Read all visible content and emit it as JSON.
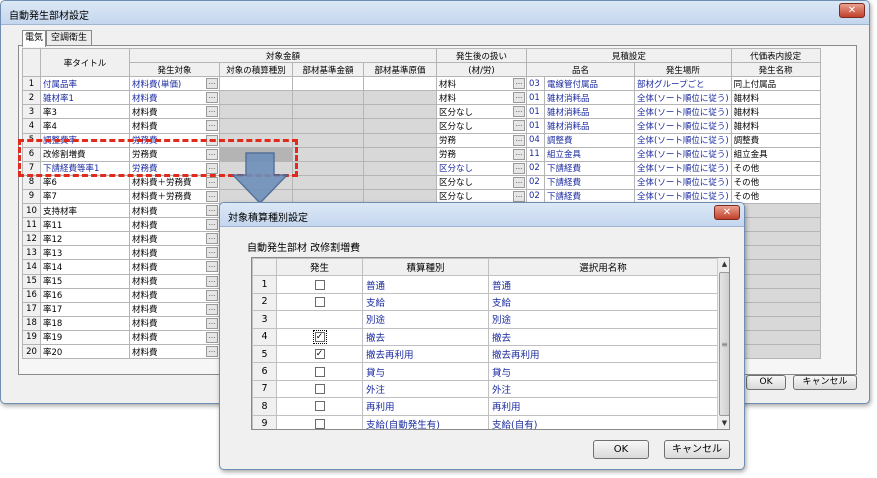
{
  "main_window": {
    "title": "自動発生部材設定",
    "tabs": [
      "電気",
      "空調衛生"
    ],
    "ok": "OK",
    "cancel": "キャンセル",
    "close_glyph": "✕"
  },
  "grid": {
    "group_headers": {
      "target_amount": "対象金額",
      "handling": "発生後の扱い",
      "estimate": "見積設定",
      "substitute": "代価表内設定"
    },
    "headers": {
      "rate_title": "率タイトル",
      "target": "発生対象",
      "accum_type": "対象の積算種別",
      "base_amount": "部材基準金額",
      "base_cost": "部材基準原価",
      "material_labor": "(材/労)",
      "item_name": "品名",
      "location": "発生場所",
      "gen_name": "発生名称"
    },
    "rows": [
      {
        "no": "1",
        "title": "付属品率",
        "target": "材料費(単価)",
        "handling": "材料",
        "code": "03",
        "name": "電線管付属品",
        "location": "部材グループごと",
        "gen": "同上付属品",
        "blue": true
      },
      {
        "no": "2",
        "title": "雑材率1",
        "target": "材料費",
        "handling": "材料",
        "code": "01",
        "name": "雑材消耗品",
        "location": "全体(ソート順位に従う)",
        "gen": "雑材料",
        "blue": true
      },
      {
        "no": "3",
        "title": "率3",
        "target": "材料費",
        "handling": "区分なし",
        "code": "01",
        "name": "雑材消耗品",
        "location": "全体(ソート順位に従う)",
        "gen": "雑材料",
        "blue": false
      },
      {
        "no": "4",
        "title": "率4",
        "target": "材料費",
        "handling": "区分なし",
        "code": "01",
        "name": "雑材消耗品",
        "location": "全体(ソート順位に従う)",
        "gen": "雑材料",
        "blue": false
      },
      {
        "no": "5",
        "title": "調整費率",
        "target": "労務費",
        "handling": "労務",
        "code": "04",
        "name": "調整費",
        "location": "全体(ソート順位に従う)",
        "gen": "調整費",
        "blue": true
      },
      {
        "no": "6",
        "title": "改修割増費",
        "target": "労務費",
        "handling": "労務",
        "code": "11",
        "name": "組立金具",
        "location": "全体(ソート順位に従う)",
        "gen": "組立金具",
        "blue": false
      },
      {
        "no": "7",
        "title": "下請経費等率1",
        "target": "労務費",
        "handling": "区分なし",
        "code": "02",
        "name": "下請経費",
        "location": "全体(ソート順位に従う)",
        "gen": "その他",
        "blue": true
      },
      {
        "no": "8",
        "title": "率6",
        "target": "材料費＋労務費",
        "handling": "区分なし",
        "code": "02",
        "name": "下請経費",
        "location": "全体(ソート順位に従う)",
        "gen": "その他",
        "blue": false
      },
      {
        "no": "9",
        "title": "率7",
        "target": "材料費＋労務費",
        "handling": "区分なし",
        "code": "02",
        "name": "下請経費",
        "location": "全体(ソート順位に従う)",
        "gen": "その他",
        "blue": false
      },
      {
        "no": "10",
        "title": "支持材率",
        "target": "材料費",
        "handling": "",
        "code": "",
        "name": "",
        "location": "",
        "gen": "",
        "blue": false
      },
      {
        "no": "11",
        "title": "率11",
        "target": "材料費",
        "handling": "",
        "code": "",
        "name": "",
        "location": "",
        "gen": "",
        "blue": false
      },
      {
        "no": "12",
        "title": "率12",
        "target": "材料費",
        "handling": "",
        "code": "",
        "name": "",
        "location": "",
        "gen": "",
        "blue": false
      },
      {
        "no": "13",
        "title": "率13",
        "target": "材料費",
        "handling": "",
        "code": "",
        "name": "",
        "location": "",
        "gen": "",
        "blue": false
      },
      {
        "no": "14",
        "title": "率14",
        "target": "材料費",
        "handling": "",
        "code": "",
        "name": "",
        "location": "",
        "gen": "",
        "blue": false
      },
      {
        "no": "15",
        "title": "率15",
        "target": "材料費",
        "handling": "",
        "code": "",
        "name": "",
        "location": "",
        "gen": "",
        "blue": false
      },
      {
        "no": "16",
        "title": "率16",
        "target": "材料費",
        "handling": "",
        "code": "",
        "name": "",
        "location": "",
        "gen": "",
        "blue": false
      },
      {
        "no": "17",
        "title": "率17",
        "target": "材料費",
        "handling": "",
        "code": "",
        "name": "",
        "location": "",
        "gen": "",
        "blue": false
      },
      {
        "no": "18",
        "title": "率18",
        "target": "材料費",
        "handling": "",
        "code": "",
        "name": "",
        "location": "",
        "gen": "",
        "blue": false
      },
      {
        "no": "19",
        "title": "率19",
        "target": "材料費",
        "handling": "",
        "code": "",
        "name": "",
        "location": "",
        "gen": "",
        "blue": false
      },
      {
        "no": "20",
        "title": "率20",
        "target": "材料費",
        "handling": "",
        "code": "",
        "name": "",
        "location": "",
        "gen": "",
        "blue": false
      }
    ]
  },
  "dialog": {
    "title": "対象積算種別設定",
    "subtitle": "自動発生部材 改修割増費",
    "headers": {
      "generate": "発生",
      "type": "積算種別",
      "display": "選択用名称"
    },
    "rows": [
      {
        "no": "1",
        "checked": false,
        "type": "普通",
        "display": "普通"
      },
      {
        "no": "2",
        "checked": false,
        "type": "支給",
        "display": "支給"
      },
      {
        "no": "3",
        "checked": null,
        "type": "別途",
        "display": "別途"
      },
      {
        "no": "4",
        "checked": true,
        "type": "撤去",
        "display": "撤去"
      },
      {
        "no": "5",
        "checked": true,
        "type": "撤去再利用",
        "display": "撤去再利用"
      },
      {
        "no": "6",
        "checked": false,
        "type": "貸与",
        "display": "貸与"
      },
      {
        "no": "7",
        "checked": false,
        "type": "外注",
        "display": "外注"
      },
      {
        "no": "8",
        "checked": false,
        "type": "再利用",
        "display": "再利用"
      },
      {
        "no": "9",
        "checked": false,
        "type": "支給(自動発生有)",
        "display": "支給(自有)"
      }
    ],
    "ok": "OK",
    "cancel": "キャンセル",
    "close_glyph": "✕"
  },
  "icons": {
    "ellipsis_button": "...",
    "scroll_up": "▲",
    "scroll_down": "▼",
    "check_mark": "✓",
    "grip": "≡"
  },
  "colors": {
    "highlight_dash": "#e02a1a",
    "blue_text": "#1a2aa0",
    "arrow_fill": "#6f8fba"
  }
}
